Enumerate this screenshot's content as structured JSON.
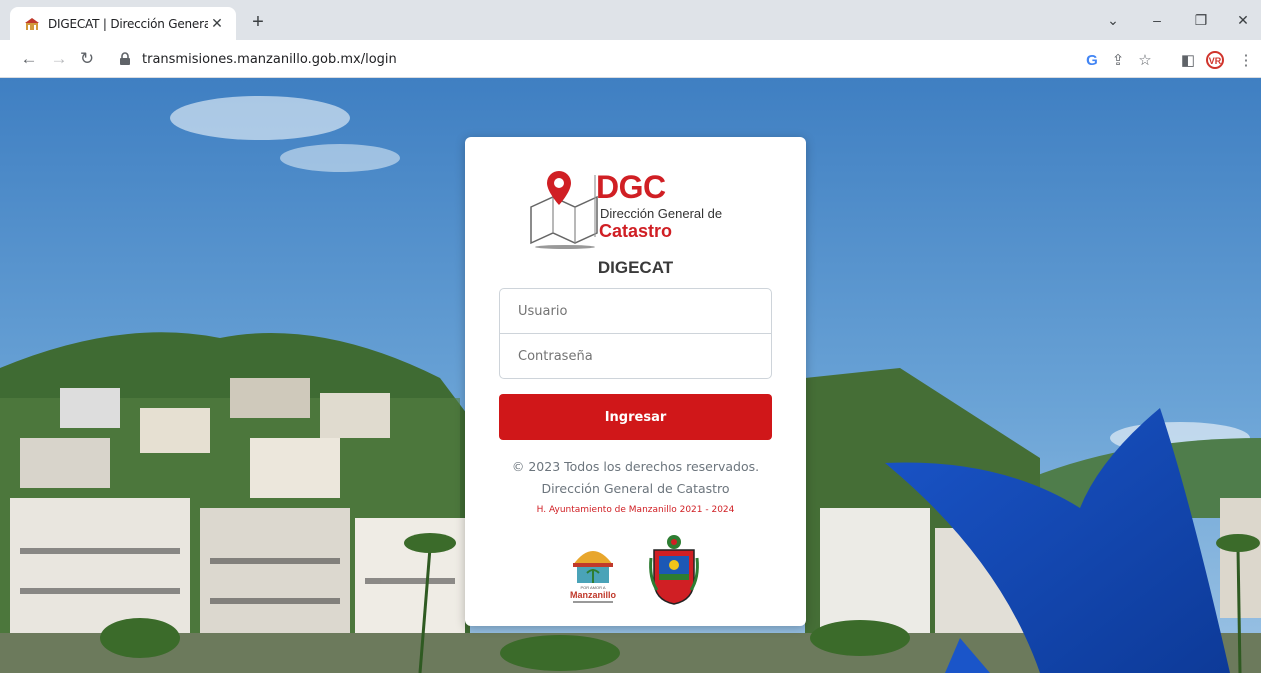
{
  "browser": {
    "tab_title": "DIGECAT | Dirección General de C",
    "url": "transmisiones.manzanillo.gob.mx/login",
    "icons": {
      "favicon": "building-favicon",
      "close": "close-icon",
      "new_tab": "plus-icon",
      "back": "back-arrow-icon",
      "forward": "forward-arrow-icon",
      "reload": "reload-icon",
      "lock": "lock-icon",
      "google": "google-icon",
      "share": "share-icon",
      "bookmark": "star-icon",
      "sidepanel": "side-panel-icon",
      "extension": "extension-icon",
      "menu": "kebab-menu-icon"
    }
  },
  "login": {
    "logo_title": "DGC",
    "logo_subtitle": "Dirección General de",
    "logo_subtitle2": "Catastro",
    "app_name": "DIGECAT",
    "username_placeholder": "Usuario",
    "password_placeholder": "Contraseña",
    "submit_label": "Ingresar",
    "copyright": "© 2023 Todos los derechos reservados.",
    "org": "Dirección General de Catastro",
    "council": "H. Ayuntamiento de Manzanillo 2021 - 2024",
    "seal1_text": "Manzanillo"
  },
  "colors": {
    "accent_red": "#d01719",
    "brand_red": "#d01f24",
    "sky": "#4a8bc9"
  }
}
